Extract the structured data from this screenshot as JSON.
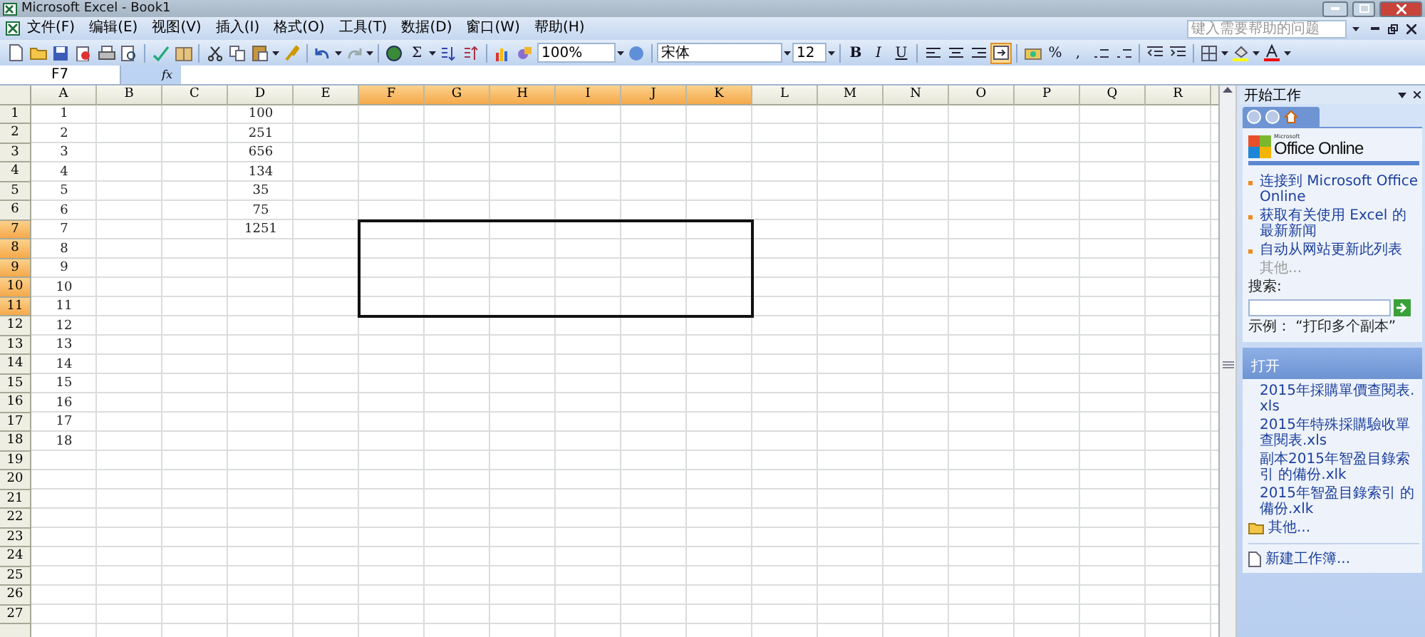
{
  "window": {
    "title": "Microsoft Excel - Book1"
  },
  "menu": [
    {
      "label": "文件(F)"
    },
    {
      "label": "编辑(E)"
    },
    {
      "label": "视图(V)"
    },
    {
      "label": "插入(I)"
    },
    {
      "label": "格式(O)"
    },
    {
      "label": "工具(T)"
    },
    {
      "label": "数据(D)"
    },
    {
      "label": "窗口(W)"
    },
    {
      "label": "帮助(H)"
    }
  ],
  "help_box": {
    "placeholder": "键入需要帮助的问题"
  },
  "standard_toolbar": {
    "autosum": "Σ",
    "zoom": "100%"
  },
  "formatting_toolbar": {
    "font": "宋体",
    "size": "12",
    "bold": "B",
    "italic": "I",
    "underline": "U",
    "percent": "%",
    "comma": ",",
    "merge_pressed": true
  },
  "formula_bar": {
    "name_box": "F7",
    "fx": "fx"
  },
  "sheet": {
    "columns": [
      {
        "label": "A",
        "selected": false
      },
      {
        "label": "B",
        "selected": false
      },
      {
        "label": "C",
        "selected": false
      },
      {
        "label": "D",
        "selected": false
      },
      {
        "label": "E",
        "selected": false
      },
      {
        "label": "F",
        "selected": true
      },
      {
        "label": "G",
        "selected": true
      },
      {
        "label": "H",
        "selected": true
      },
      {
        "label": "I",
        "selected": true
      },
      {
        "label": "J",
        "selected": true
      },
      {
        "label": "K",
        "selected": true
      },
      {
        "label": "L",
        "selected": false
      },
      {
        "label": "M",
        "selected": false
      },
      {
        "label": "N",
        "selected": false
      },
      {
        "label": "O",
        "selected": false
      },
      {
        "label": "P",
        "selected": false
      },
      {
        "label": "Q",
        "selected": false
      },
      {
        "label": "R",
        "selected": false
      }
    ],
    "rows": [
      {
        "header": "1",
        "selected": false,
        "a": "1",
        "d": "100"
      },
      {
        "header": "2",
        "selected": false,
        "a": "2",
        "d": "251"
      },
      {
        "header": "3",
        "selected": false,
        "a": "3",
        "d": "656"
      },
      {
        "header": "4",
        "selected": false,
        "a": "4",
        "d": "134"
      },
      {
        "header": "5",
        "selected": false,
        "a": "5",
        "d": "35"
      },
      {
        "header": "6",
        "selected": false,
        "a": "6",
        "d": "75"
      },
      {
        "header": "7",
        "selected": true,
        "a": "7",
        "d": "1251"
      },
      {
        "header": "8",
        "selected": true,
        "a": "8"
      },
      {
        "header": "9",
        "selected": true,
        "a": "9"
      },
      {
        "header": "10",
        "selected": true,
        "a": "10"
      },
      {
        "header": "11",
        "selected": true,
        "a": "11"
      },
      {
        "header": "12",
        "selected": false,
        "a": "12"
      },
      {
        "header": "13",
        "selected": false,
        "a": "13"
      },
      {
        "header": "14",
        "selected": false,
        "a": "14"
      },
      {
        "header": "15",
        "selected": false,
        "a": "15"
      },
      {
        "header": "16",
        "selected": false,
        "a": "16"
      },
      {
        "header": "17",
        "selected": false,
        "a": "17"
      },
      {
        "header": "18",
        "selected": false,
        "a": "18"
      },
      {
        "header": "19",
        "selected": false
      },
      {
        "header": "20",
        "selected": false
      },
      {
        "header": "21",
        "selected": false
      },
      {
        "header": "22",
        "selected": false
      },
      {
        "header": "23",
        "selected": false
      },
      {
        "header": "24",
        "selected": false
      },
      {
        "header": "25",
        "selected": false
      },
      {
        "header": "26",
        "selected": false
      },
      {
        "header": "27",
        "selected": false
      }
    ]
  },
  "task_pane": {
    "title": "开始工作",
    "logo_small": "Microsoft",
    "logo": "Office Online",
    "links": [
      {
        "label": "连接到 Microsoft Office Online",
        "disabled": false
      },
      {
        "label": "获取有关使用 Excel 的最新新闻",
        "disabled": false
      },
      {
        "label": "自动从网站更新此列表",
        "disabled": false
      },
      {
        "label": "其他...",
        "disabled": true
      }
    ],
    "search_label": "搜索:",
    "example": "示例： “打印多个副本”",
    "open_title": "打开",
    "files": [
      "2015年採購單價查閱表.xls",
      "2015年特殊採購驗收單查閱表.xls",
      "副本2015年智盈目錄索引 的備份.xlk",
      "2015年智盈目錄索引 的備份.xlk"
    ],
    "more": "其他...",
    "new_workbook": "新建工作簿..."
  }
}
